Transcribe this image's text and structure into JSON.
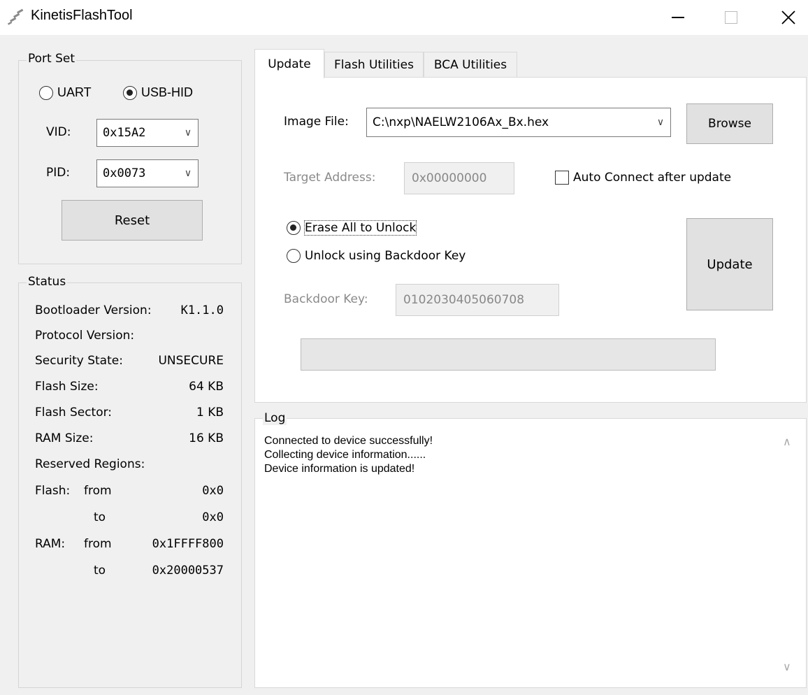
{
  "window": {
    "title": "KinetisFlashTool"
  },
  "port_set": {
    "label": "Port Set",
    "uart_label": "UART",
    "usb_hid_label": "USB-HID",
    "selected": "USB-HID",
    "vid_label": "VID:",
    "vid_value": "0x15A2",
    "pid_label": "PID:",
    "pid_value": "0x0073",
    "reset_label": "Reset"
  },
  "status": {
    "label": "Status",
    "bootloader_version_label": "Bootloader Version:",
    "bootloader_version": "K1.1.0",
    "protocol_version_label": "Protocol Version:",
    "protocol_version": "",
    "security_state_label": "Security State:",
    "security_state": "UNSECURE",
    "flash_size_label": "Flash Size:",
    "flash_size": "64 KB",
    "flash_sector_label": "Flash Sector:",
    "flash_sector": "1 KB",
    "ram_size_label": "RAM Size:",
    "ram_size": "16 KB",
    "reserved_regions_label": "Reserved Regions:",
    "flash_label": "Flash:",
    "from_label": "from",
    "to_label": "to",
    "flash_from": "0x0",
    "flash_to": "0x0",
    "ram_label": "RAM:",
    "ram_from": "0x1FFFF800",
    "ram_to": "0x20000537"
  },
  "tabs": [
    {
      "label": "Update",
      "active": true
    },
    {
      "label": "Flash Utilities",
      "active": false
    },
    {
      "label": "BCA Utilities",
      "active": false
    }
  ],
  "update": {
    "image_file_label": "Image File:",
    "image_file_value": "C:\\nxp\\NAELW2106Ax_Bx.hex",
    "browse_label": "Browse",
    "target_address_label": "Target Address:",
    "target_address_value": "0x00000000",
    "auto_connect_label": "Auto Connect after update",
    "auto_connect_checked": false,
    "erase_all_label": "Erase All to Unlock",
    "unlock_backdoor_label": "Unlock using Backdoor Key",
    "selected_unlock": "Erase All to Unlock",
    "backdoor_key_label": "Backdoor Key:",
    "backdoor_key_value": "0102030405060708",
    "update_label": "Update",
    "progress": 0
  },
  "log": {
    "label": "Log",
    "lines": [
      "Connected to device successfully!",
      "Collecting device information......",
      "Device information is updated!"
    ]
  },
  "icons": {
    "app": "kinetis-logo-icon",
    "minimize": "minimize-icon",
    "maximize": "maximize-icon",
    "close": "close-icon",
    "dropdown": "chevron-down-icon",
    "scroll_up": "chevron-up-icon",
    "scroll_down": "chevron-down-icon"
  }
}
